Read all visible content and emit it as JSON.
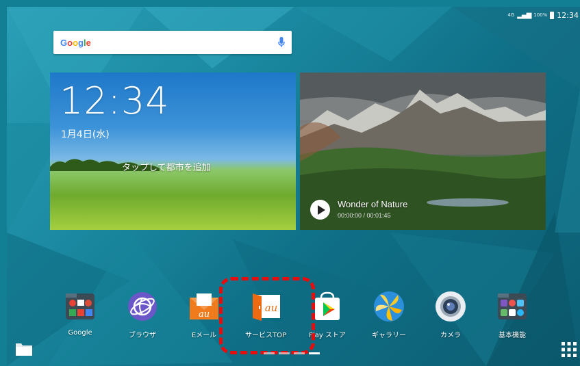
{
  "status_bar": {
    "network_label": "4G",
    "battery_level": "100%",
    "time": "12:34"
  },
  "search": {
    "logo_letters": [
      "G",
      "o",
      "o",
      "g",
      "l",
      "e"
    ]
  },
  "weather_widget": {
    "time": "12:34",
    "date": "1月4日(水)",
    "hint": "タップして都市を追加"
  },
  "video_widget": {
    "title": "Wonder of Nature",
    "time": "00:00:00 / 00:01:45"
  },
  "dock": {
    "apps": [
      {
        "label": "Google",
        "icon": "google-folder-icon"
      },
      {
        "label": "ブラウザ",
        "icon": "browser-icon"
      },
      {
        "label": "Eメール",
        "icon": "email-icon"
      },
      {
        "label": "サービスTOP",
        "icon": "au-service-top-icon"
      },
      {
        "label": "Play ストア",
        "icon": "play-store-icon"
      },
      {
        "label": "ギャラリー",
        "icon": "gallery-icon"
      },
      {
        "label": "カメラ",
        "icon": "camera-icon"
      },
      {
        "label": "基本機能",
        "icon": "basic-functions-folder-icon"
      }
    ]
  },
  "highlight_color": "#e50d0d",
  "accent_color": "#127f95"
}
